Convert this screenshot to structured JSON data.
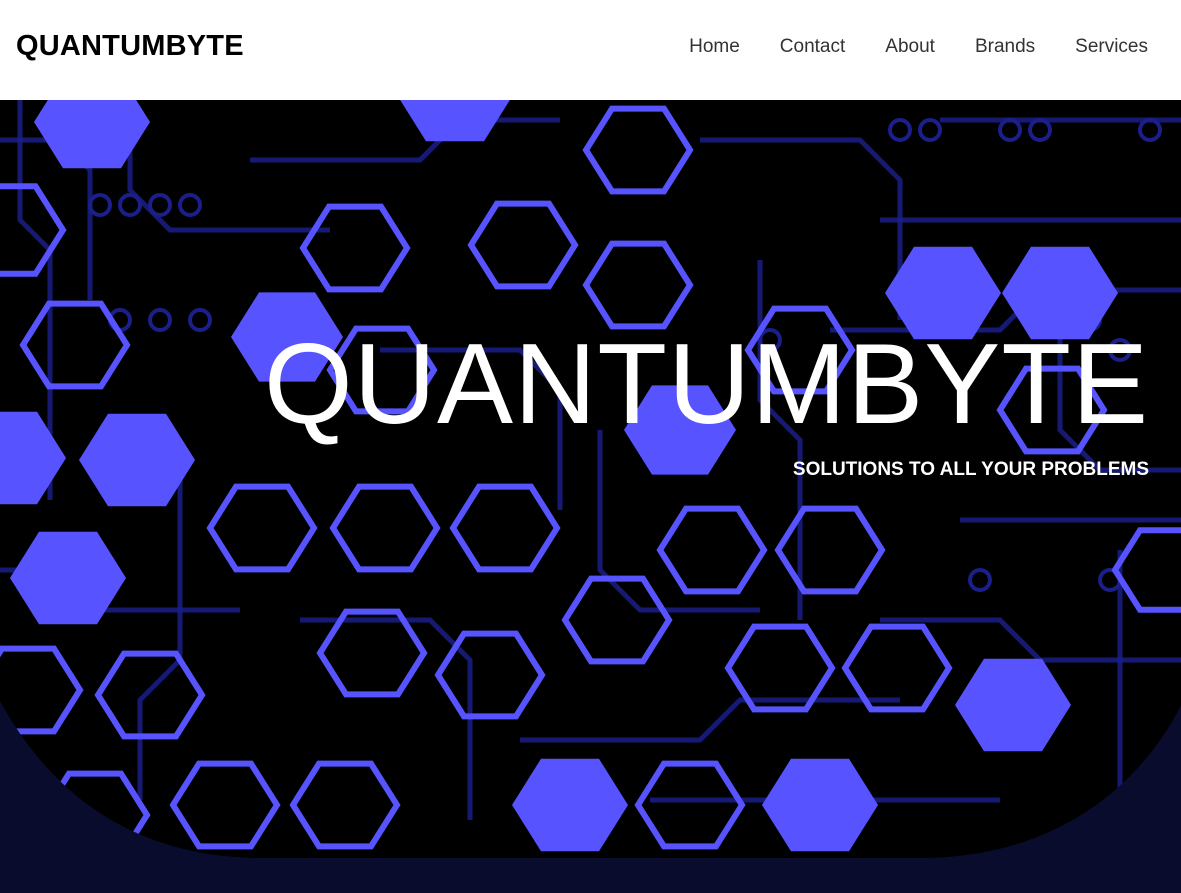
{
  "header": {
    "logo": "QUANTUMBYTE",
    "nav": [
      {
        "label": "Home"
      },
      {
        "label": "Contact"
      },
      {
        "label": "About"
      },
      {
        "label": "Brands"
      },
      {
        "label": "Services"
      }
    ]
  },
  "hero": {
    "title": "QUANTUMBYTE",
    "subtitle": "SOLUTIONS TO ALL YOUR PROBLEMS",
    "background_image": "circuit-hexagon-pattern"
  },
  "colors": {
    "header_bg": "#ffffff",
    "hero_dark": "#000000",
    "hexagon": "#5754ff",
    "trace": "#1a1f8a",
    "footer_wave": "#0a0c2e",
    "text_light": "#ffffff"
  }
}
